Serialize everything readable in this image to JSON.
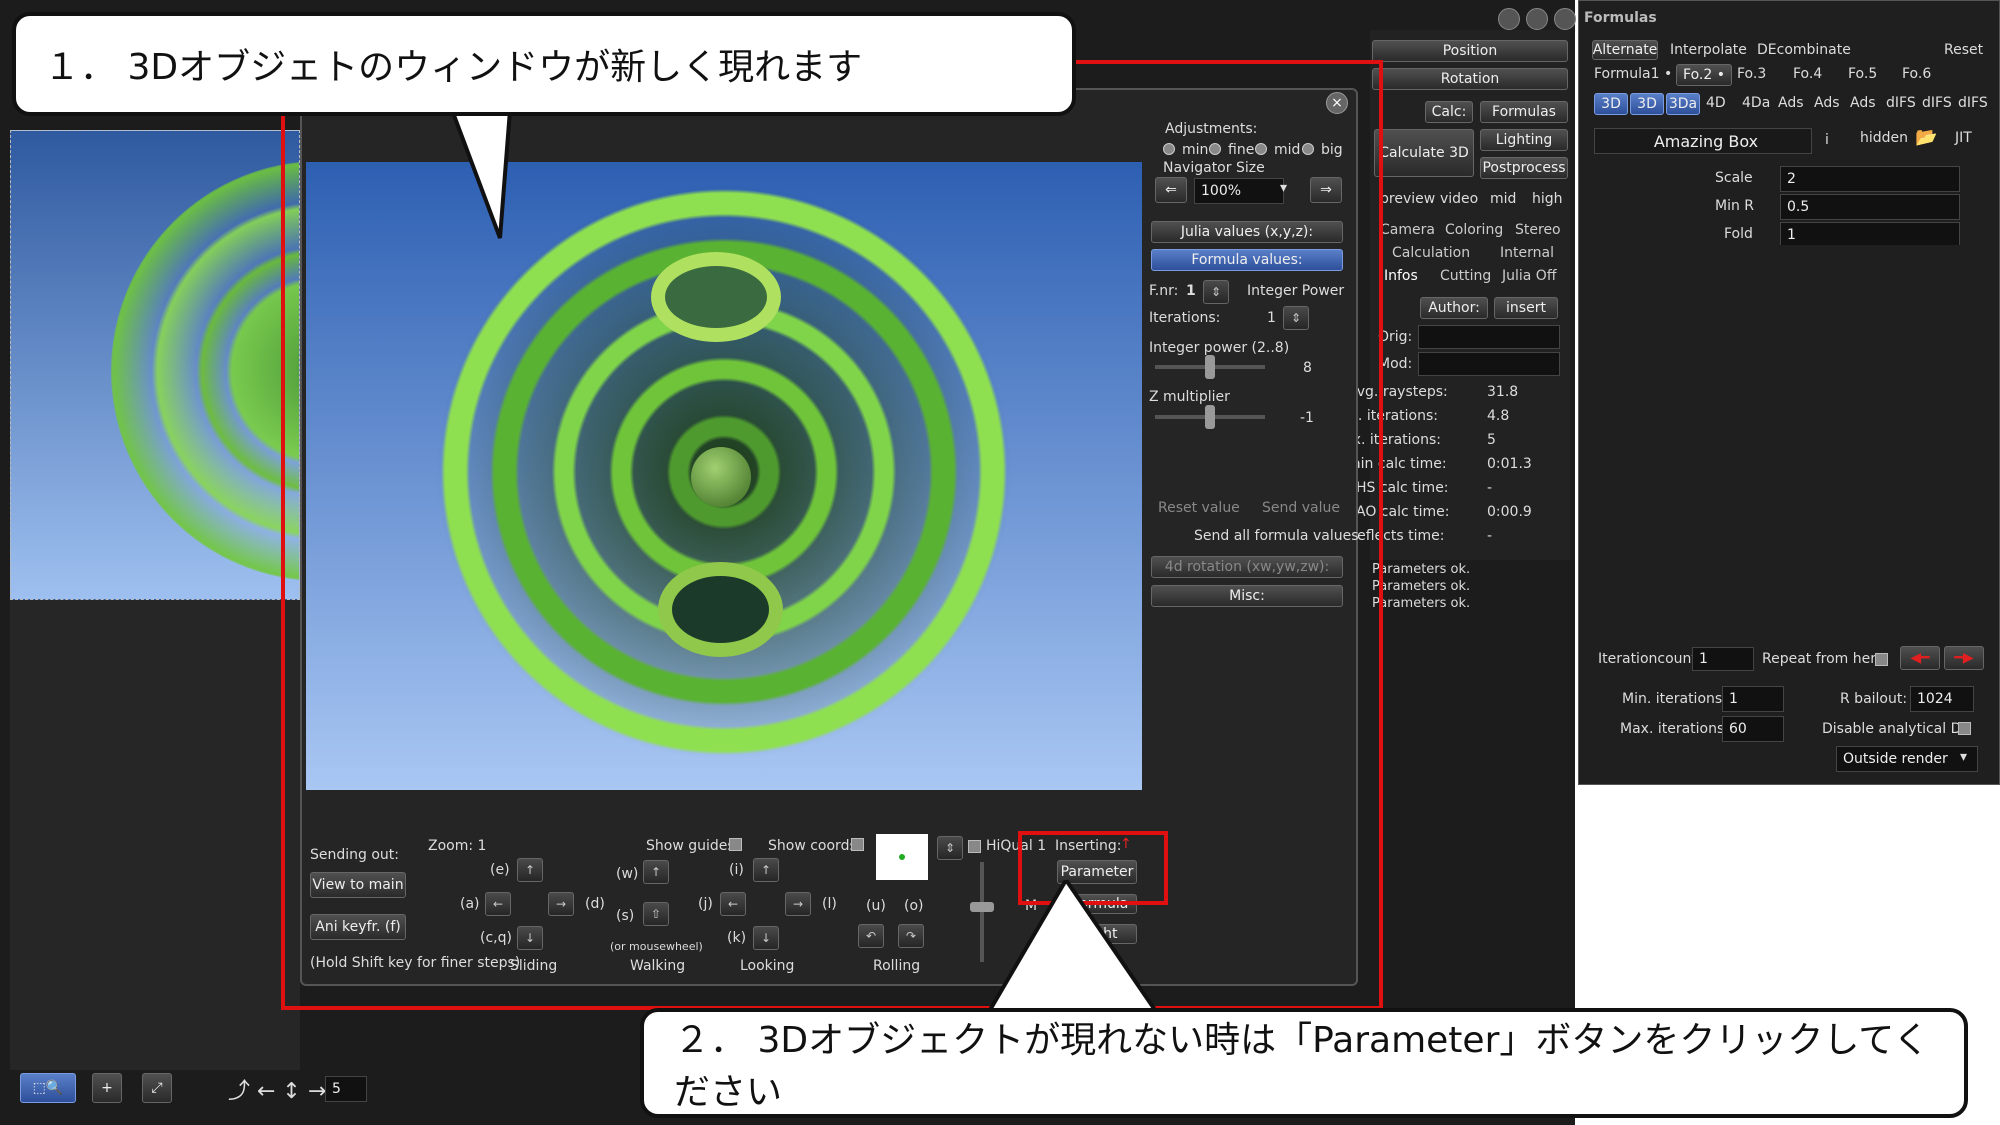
{
  "callouts": {
    "top": "１． 3Dオブジェトのウィンドウが新しく現れます",
    "bottom": "２． 3Dオブジェクトが現れない時は「Parameter」ボタンをクリックしてください"
  },
  "nav": {
    "adjustments": "Adjustments:",
    "min": "min",
    "fine": "fine",
    "mid": "mid",
    "big": "big",
    "navigator_size": "Navigator Size",
    "size_value": "100%",
    "julia_values": "Julia values (x,y,z):",
    "formula_values": "Formula values:",
    "fnr_label": "F.nr:",
    "fnr_value": "1",
    "formula_name": "Integer Power",
    "iterations_label": "Iterations:",
    "iterations_value": "1",
    "int_power_label": "Integer power (2..8)",
    "int_power_value": "8",
    "z_mult_label": "Z multiplier",
    "z_mult_value": "-1",
    "reset_value": "Reset value",
    "send_value": "Send value",
    "send_all": "Send all formula values",
    "rot4d": "4d rotation (xw,yw,zw):",
    "misc": "Misc:"
  },
  "navbottom": {
    "sending_out": "Sending out:",
    "view_to_main": "View to main",
    "ani_keyfr": "Ani keyfr. (f)",
    "hint": "(Hold Shift key for finer steps)",
    "zoom": "Zoom: 1",
    "show_guides": "Show guides",
    "show_coords": "Show coords",
    "hiqual": "HiQual 1",
    "inserting": "Inserting:",
    "parameter": "Parameter",
    "formula": "Formula",
    "light": "Light",
    "k_e": "(e)",
    "k_a": "(a)",
    "k_d": "(d)",
    "k_cq": "(c,q)",
    "k_w": "(w)",
    "k_s": "(s)",
    "k_mw": "(or mousewheel)",
    "k_i": "(i)",
    "k_j": "(j)",
    "k_l": "(l)",
    "k_k": "(k)",
    "k_u": "(u)",
    "k_o": "(o)",
    "sliding": "Sliding",
    "walking": "Walking",
    "looking": "Looking",
    "rolling": "Rolling",
    "m": "M"
  },
  "main": {
    "position": "Position",
    "rotation": "Rotation",
    "calc": "Calc:",
    "formulas": "Formulas",
    "lighting": "Lighting",
    "calculate3d": "Calculate 3D",
    "postprocess": "Postprocess",
    "preview": "preview",
    "video": "video",
    "mid": "mid",
    "high": "high",
    "tabs1": [
      "Camera",
      "Coloring",
      "Stereo"
    ],
    "tabs2": [
      "Calculation",
      "Internal"
    ],
    "tabs3": [
      "Infos",
      "Cutting",
      "Julia Off"
    ],
    "author": "Author:",
    "insert": "insert",
    "orig": "Orig:",
    "mod": "Mod:",
    "stats": [
      {
        "k": "Avg. raysteps:",
        "v": "31.8"
      },
      {
        "k": "Avg. iterations:",
        "v": "4.8"
      },
      {
        "k": "Max. iterations:",
        "v": "5"
      },
      {
        "k": "Main calc time:",
        "v": "0:01.3"
      },
      {
        "k": "HS calc time:",
        "v": "-"
      },
      {
        "k": "AO calc time:",
        "v": "0:00.9"
      },
      {
        "k": "Reflects time:",
        "v": "-"
      }
    ],
    "log": [
      "Parameters ok.",
      "Parameters ok.",
      "Parameters ok."
    ],
    "zoom_value": "5"
  },
  "formulas": {
    "title": "Formulas",
    "alternate": "Alternate",
    "interpolate": "Interpolate",
    "decombinate": "DEcombinate",
    "reset": "Reset",
    "slots": [
      "Formula1 •",
      "Fo.2 •",
      "Fo.3",
      "Fo.4",
      "Fo.5",
      "Fo.6"
    ],
    "modes": [
      "3D",
      "3D",
      "3Da",
      "4D",
      "4Da",
      "Ads",
      "Ads",
      "Ads",
      "dIFS",
      "dIFS",
      "dIFS"
    ],
    "name": "Amazing Box",
    "info": "i",
    "hidden": "hidden",
    "jit": "JIT",
    "params": [
      {
        "k": "Scale",
        "v": "2"
      },
      {
        "k": "Min R",
        "v": "0.5"
      },
      {
        "k": "Fold",
        "v": "1"
      }
    ],
    "itercount_label": "Iterationcount",
    "itercount": "1",
    "repeat": "Repeat from here",
    "min_iter_label": "Min. iterations:",
    "min_iter": "1",
    "rbailout_label": "R bailout:",
    "rbailout": "1024",
    "max_iter_label": "Max. iterations:",
    "max_iter": "60",
    "disable_de": "Disable analytical DE",
    "outside": "Outside render"
  }
}
